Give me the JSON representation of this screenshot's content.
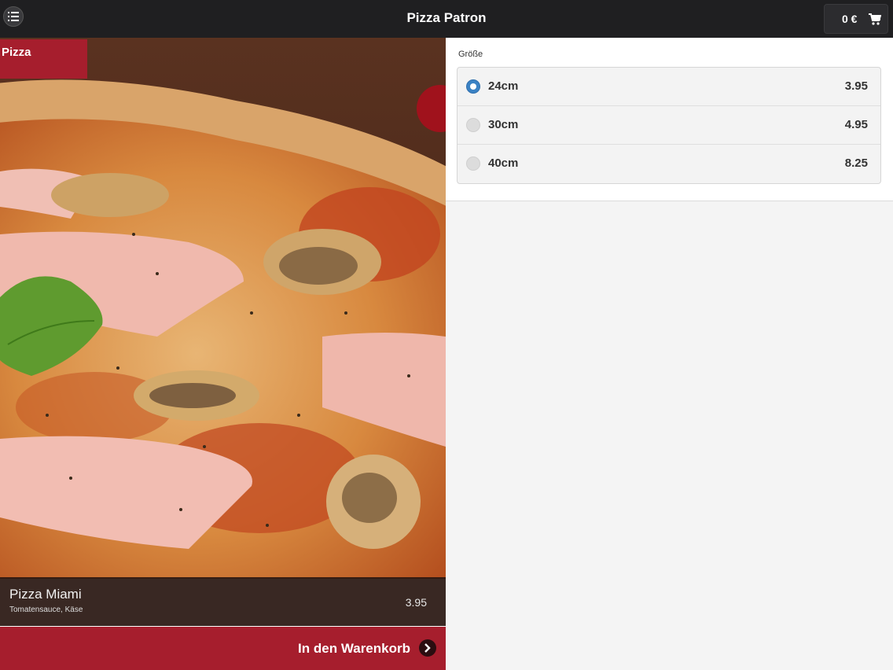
{
  "header": {
    "title": "Pizza Patron",
    "cart_total": "0 €",
    "menu_icon": "list-icon",
    "cart_icon": "cart-icon"
  },
  "product": {
    "category": "Pizza",
    "name": "Pizza Miami",
    "description": "Tomatensauce, Käse",
    "price": "3.95",
    "add_to_cart_label": "In den Warenkorb"
  },
  "size_group": {
    "label": "Größe",
    "options": [
      {
        "label": "24cm",
        "price": "3.95",
        "selected": true
      },
      {
        "label": "30cm",
        "price": "4.95",
        "selected": false
      },
      {
        "label": "40cm",
        "price": "8.25",
        "selected": false
      }
    ]
  },
  "colors": {
    "header_bg": "#1f1f21",
    "accent": "#a61e2d",
    "radio_selected": "#3b82c4"
  }
}
